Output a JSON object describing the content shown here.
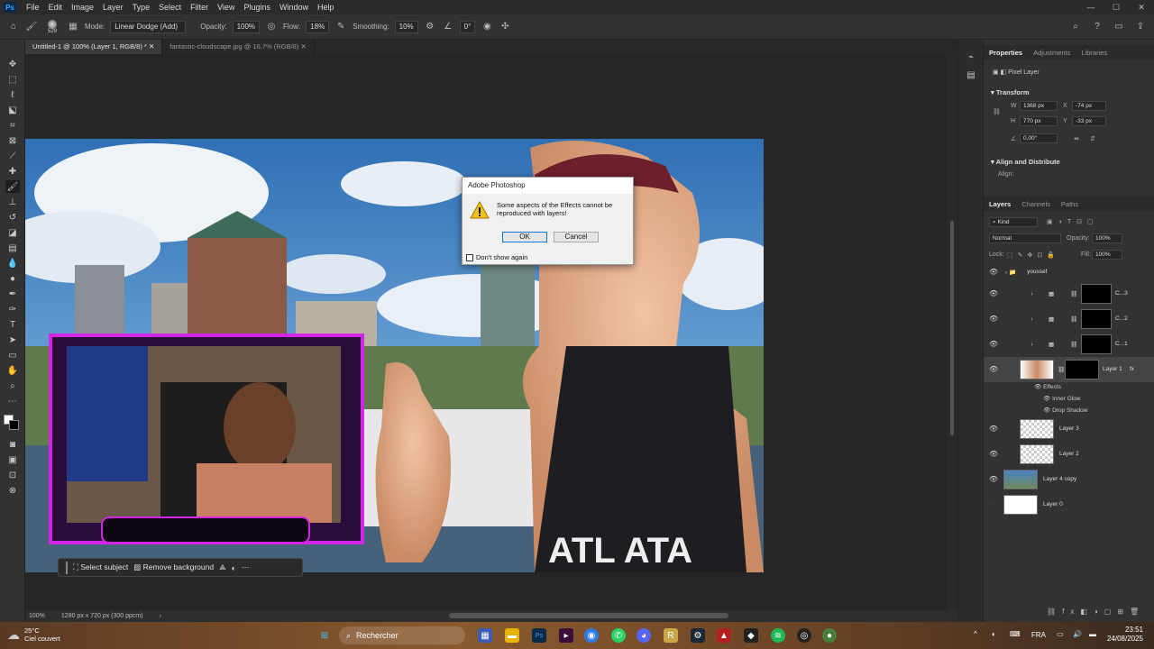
{
  "app": {
    "logo": "Ps",
    "menus": [
      "File",
      "Edit",
      "Image",
      "Layer",
      "Type",
      "Select",
      "Filter",
      "View",
      "Plugins",
      "Window",
      "Help"
    ]
  },
  "options": {
    "brush_size": "529",
    "mode_label": "Mode:",
    "mode_value": "Linear Dodge (Add)",
    "opacity_label": "Opacity:",
    "opacity_value": "100%",
    "flow_label": "Flow:",
    "flow_value": "18%",
    "smoothing_label": "Smoothing:",
    "smoothing_value": "10%",
    "angle_value": "0°"
  },
  "tabs": [
    {
      "label": "Untitled-1 @ 100% (Layer 1, RGB/8) *"
    },
    {
      "label": "fantastic-cloudscape.jpg @ 16,7% (RGB/8)"
    }
  ],
  "status": {
    "zoom": "100%",
    "doc_size": "1280 px x 720 px (300 ppcm)"
  },
  "context_bar": {
    "select_subject": "Select subject",
    "remove_background": "Remove background"
  },
  "dialog": {
    "title": "Adobe Photoshop",
    "message": "Some aspects of the Effects cannot be reproduced with layers!",
    "ok": "OK",
    "cancel": "Cancel",
    "dont_show": "Don't show again"
  },
  "panels": {
    "top_tabs": [
      "Properties",
      "Adjustments",
      "Libraries"
    ],
    "pixel_layer": "Pixel Layer",
    "transform": {
      "title": "Transform",
      "w": "1368 px",
      "h": "770 px",
      "x": "-74 px",
      "y": "-33 px",
      "angle": "0,00°"
    },
    "align_title": "Align and Distribute",
    "align_label": "Align:",
    "layer_tabs": [
      "Layers",
      "Channels",
      "Paths"
    ],
    "kind": "Kind",
    "blend_mode": "Normal",
    "opacity_label": "Opacity:",
    "opacity": "100%",
    "lock_label": "Lock:",
    "fill_label": "Fill:",
    "fill": "100%",
    "layers": [
      {
        "name": "youssef",
        "type": "group"
      },
      {
        "name": "C...3",
        "type": "adjust"
      },
      {
        "name": "C...2",
        "type": "adjust"
      },
      {
        "name": "C...1",
        "type": "adjust"
      },
      {
        "name": "Layer 1",
        "type": "pixel",
        "fx": "fx"
      },
      {
        "name": "Layer 3",
        "type": "pixel"
      },
      {
        "name": "Layer 2",
        "type": "pixel"
      },
      {
        "name": "Layer 4 copy",
        "type": "pixel"
      },
      {
        "name": "Layer 0",
        "type": "pixel"
      }
    ],
    "effects_label": "Effects",
    "effects": [
      "Inner Glow",
      "Drop Shadow"
    ]
  },
  "taskbar": {
    "temp": "25°C",
    "weather": "Ciel couvert",
    "search": "Rechercher",
    "lang": "FRA",
    "time": "23:51",
    "date": "24/08/2025"
  }
}
